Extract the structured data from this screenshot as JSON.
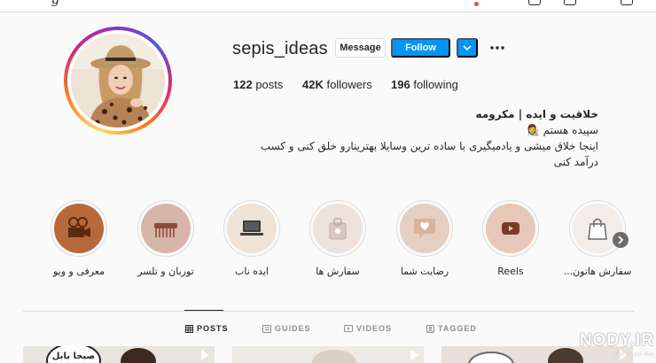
{
  "profile": {
    "username": "sepis_ideas",
    "posts_count": "122",
    "posts_label": "posts",
    "followers_count": "42K",
    "followers_label": "followers",
    "following_count": "196",
    "following_label": "following",
    "bio_name": "خلاقیت و ایده | مکرومه",
    "bio_line1": "سپیده هستم 👩‍🎨",
    "bio_line2": "اینجا خلاق میشی و یادمیگیری با ساده ترین وسایلا بهترینارو خلق کنی و کسب درآمد کنی"
  },
  "actions": {
    "message_label": "Message",
    "follow_label": "Follow"
  },
  "highlights": [
    {
      "label": "معرفی و ویو",
      "icon": "camera-icon",
      "color": "#b8693a"
    },
    {
      "label": "توربان و تلسر",
      "icon": "comb-icon",
      "color": "#d7b6a9"
    },
    {
      "label": "ایده ناب",
      "icon": "laptop-icon",
      "color": "#efe2d6"
    },
    {
      "label": "سفارش ها",
      "icon": "gift-icon",
      "color": "#eee2dc"
    },
    {
      "label": "رضایت شما",
      "icon": "heart-message-icon",
      "color": "#e4cfc1"
    },
    {
      "label": "Reels",
      "icon": "youtube-play-icon",
      "color": "#e7c8b8"
    },
    {
      "label": "سفارش هاتون...",
      "icon": "shopping-bag-icon",
      "color": "#f3ede9"
    }
  ],
  "tabs": [
    {
      "label": "POSTS",
      "icon": "grid-icon",
      "active": true
    },
    {
      "label": "GUIDES",
      "icon": "guides-icon",
      "active": false
    },
    {
      "label": "VIDEOS",
      "icon": "video-icon",
      "active": false
    },
    {
      "label": "TAGGED",
      "icon": "tag-icon",
      "active": false
    }
  ],
  "colors": {
    "follow_blue": "#0095f6",
    "text": "#262626",
    "muted": "#8e8e8e",
    "border": "#dbdbdb",
    "background": "#fafafa"
  },
  "watermark": {
    "main": "NODY.IR",
    "sub": "مجله اینترنتی ایران"
  },
  "thumbnails": {
    "first_overlay": "صبحا بابل"
  }
}
